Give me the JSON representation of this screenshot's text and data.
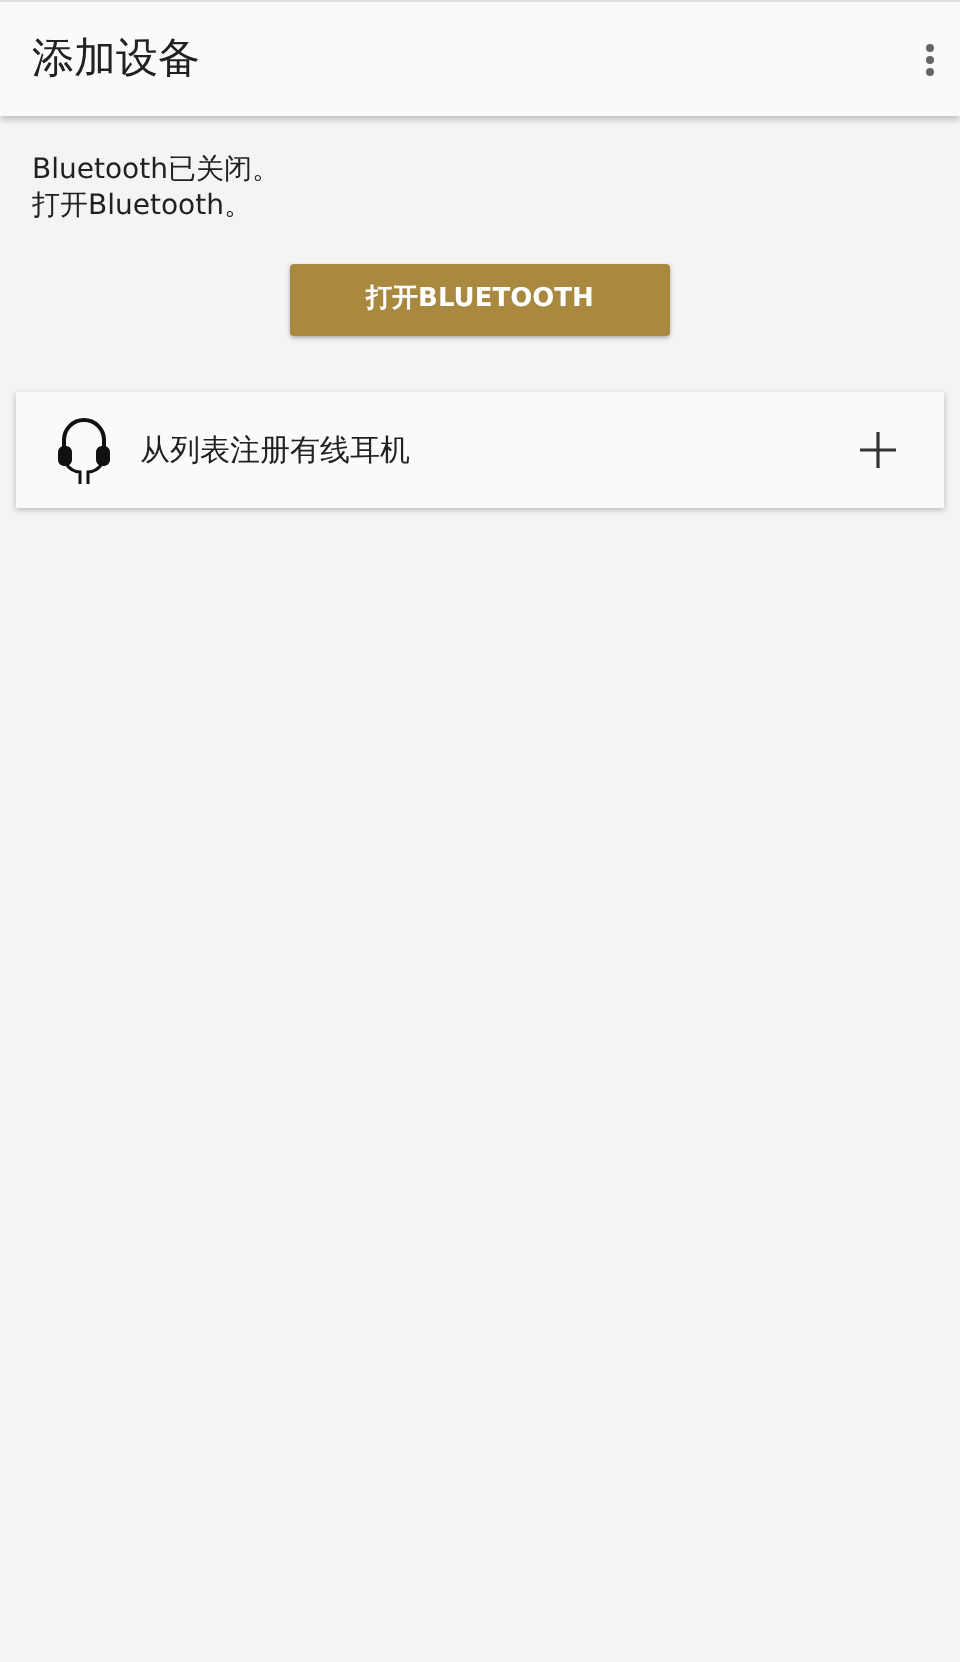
{
  "app_bar": {
    "title": "添加设备"
  },
  "message": [
    "Bluetooth已关闭。",
    "打开Bluetooth。"
  ],
  "enable_button": {
    "label": "打开BLUETOOTH"
  },
  "list": [
    {
      "label": "从列表注册有线耳机"
    }
  ]
}
